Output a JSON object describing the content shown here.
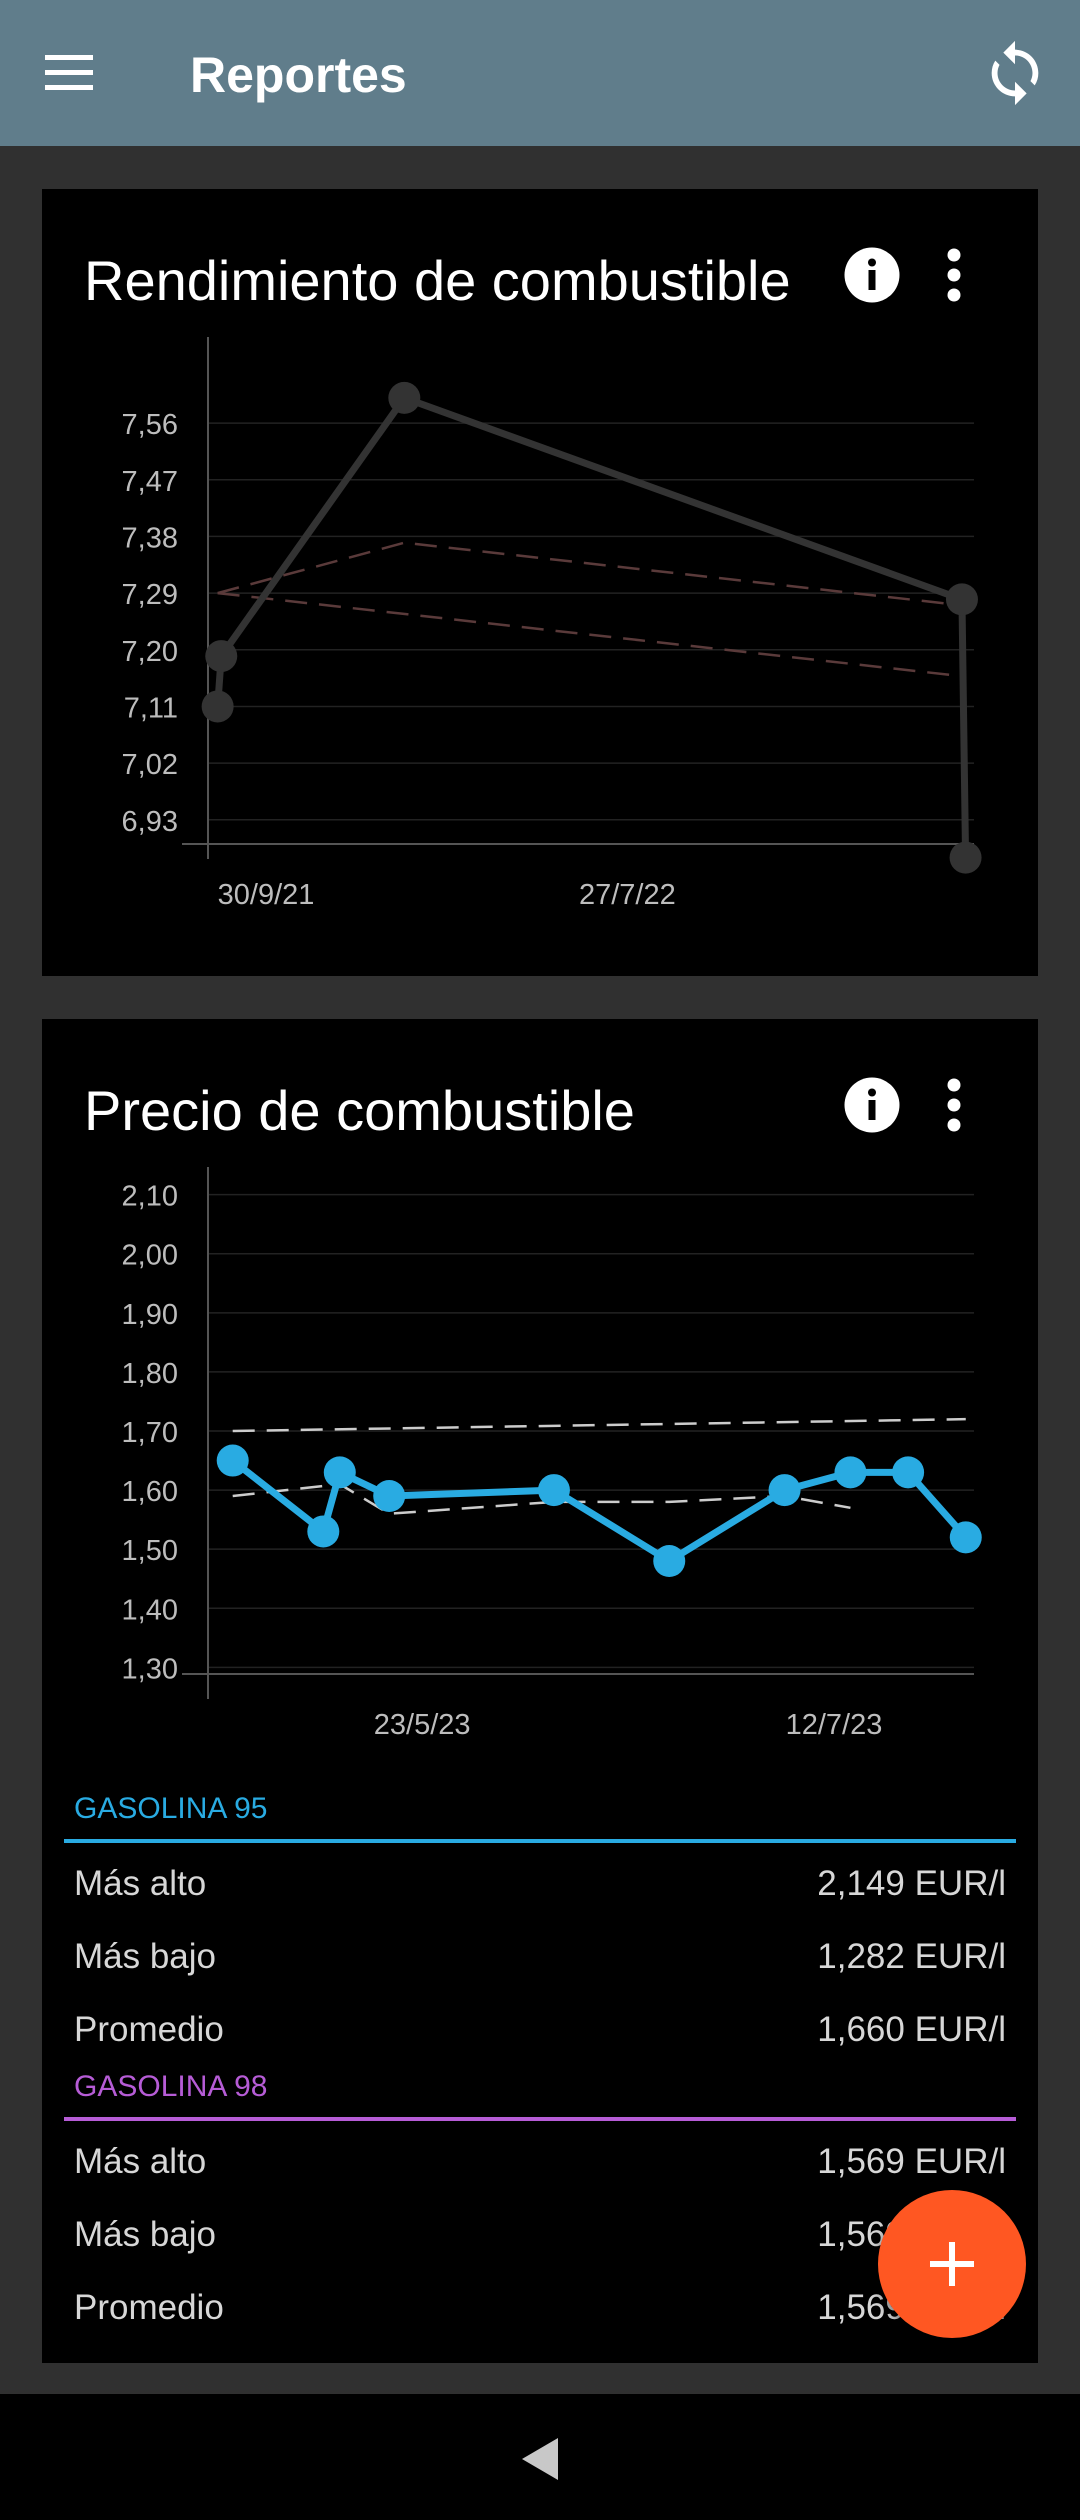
{
  "app": {
    "title": "Reportes"
  },
  "icons": {
    "menu": "hamburger-icon",
    "sync": "sync-icon",
    "info": "info-icon",
    "more": "more-vert-icon",
    "add": "plus-icon",
    "back": "back-triangle-icon"
  },
  "colors": {
    "appbar": "#607d8b",
    "gasolina95": "#29abe2",
    "gasolina98": "#b65cd6",
    "fab": "#ff5722",
    "card": "#000000",
    "background": "#303030"
  },
  "charts": {
    "rendimiento": {
      "title": "Rendimiento de combustible"
    },
    "precio": {
      "title": "Precio de combustible"
    }
  },
  "chart_data": [
    {
      "type": "line",
      "title": "Rendimiento de combustible",
      "ylim": [
        6.89,
        7.63
      ],
      "yticks": [
        "7,56",
        "7,47",
        "7,38",
        "7,29",
        "7,20",
        "7,11",
        "7,02",
        "6,93"
      ],
      "ytick_values": [
        7.56,
        7.47,
        7.38,
        7.29,
        7.2,
        7.11,
        7.02,
        6.93
      ],
      "xticks": [
        "30/9/21",
        "27/7/22"
      ],
      "xtick_values": [
        "2021-09-30",
        "2022-07-27"
      ],
      "xlim": [
        "2021-09-22",
        "2023-06-20"
      ],
      "grid": true,
      "series": [
        {
          "color": "#333333",
          "x": [
            "2021-09-30",
            "2021-10-03",
            "2022-03-04",
            "2023-06-10",
            "2023-06-13"
          ],
          "y": [
            7.11,
            7.19,
            7.6,
            7.28,
            6.87
          ]
        }
      ],
      "trend_lines": [
        {
          "color": "#5a3a3a",
          "x": [
            "2021-09-30",
            "2022-03-04",
            "2023-06-13"
          ],
          "y": [
            7.29,
            7.37,
            7.27
          ]
        },
        {
          "color": "#5a3a3a",
          "x": [
            "2021-09-30",
            "2023-06-01"
          ],
          "y": [
            7.29,
            7.16
          ]
        }
      ]
    },
    {
      "type": "line",
      "title": "Precio de combustible",
      "ylim": [
        1.26,
        2.14
      ],
      "yticks": [
        "2,10",
        "2,00",
        "1,90",
        "1,80",
        "1,70",
        "1,60",
        "1,50",
        "1,40",
        "1,30"
      ],
      "ytick_values": [
        2.1,
        2.0,
        1.9,
        1.8,
        1.7,
        1.6,
        1.5,
        1.4,
        1.3
      ],
      "xticks": [
        "23/5/23",
        "12/7/23"
      ],
      "xtick_values": [
        "2023-05-23",
        "2023-07-12"
      ],
      "xlim": [
        "2023-04-27",
        "2023-07-29"
      ],
      "grid": true,
      "series": [
        {
          "name": "GASOLINA 95",
          "color": "#29abe2",
          "x": [
            "2023-04-30",
            "2023-05-11",
            "2023-05-13",
            "2023-05-19",
            "2023-06-08",
            "2023-06-22",
            "2023-07-06",
            "2023-07-14",
            "2023-07-21",
            "2023-07-28"
          ],
          "y": [
            1.65,
            1.53,
            1.63,
            1.59,
            1.6,
            1.48,
            1.6,
            1.63,
            1.63,
            1.52
          ]
        }
      ],
      "trend_lines": [
        {
          "color": "#cccccc",
          "x": [
            "2023-04-30",
            "2023-07-28"
          ],
          "y": [
            1.7,
            1.72
          ]
        },
        {
          "color": "#cccccc",
          "x": [
            "2023-04-30",
            "2023-05-13",
            "2023-05-19",
            "2023-06-08",
            "2023-06-22",
            "2023-07-06",
            "2023-07-14"
          ],
          "y": [
            1.59,
            1.61,
            1.56,
            1.58,
            1.58,
            1.59,
            1.57
          ]
        }
      ]
    }
  ],
  "stats": {
    "gasolina95": {
      "title": "GASOLINA 95",
      "rows": [
        {
          "label": "Más alto",
          "value": "2,149 EUR/l"
        },
        {
          "label": "Más bajo",
          "value": "1,282 EUR/l"
        },
        {
          "label": "Promedio",
          "value": "1,660 EUR/l"
        }
      ]
    },
    "gasolina98": {
      "title": "GASOLINA 98",
      "rows": [
        {
          "label": "Más alto",
          "value": "1,569 EUR/l"
        },
        {
          "label": "Más bajo",
          "value": "1,569 EUR/l"
        },
        {
          "label": "Promedio",
          "value": "1,569 EUR/l"
        }
      ]
    }
  }
}
